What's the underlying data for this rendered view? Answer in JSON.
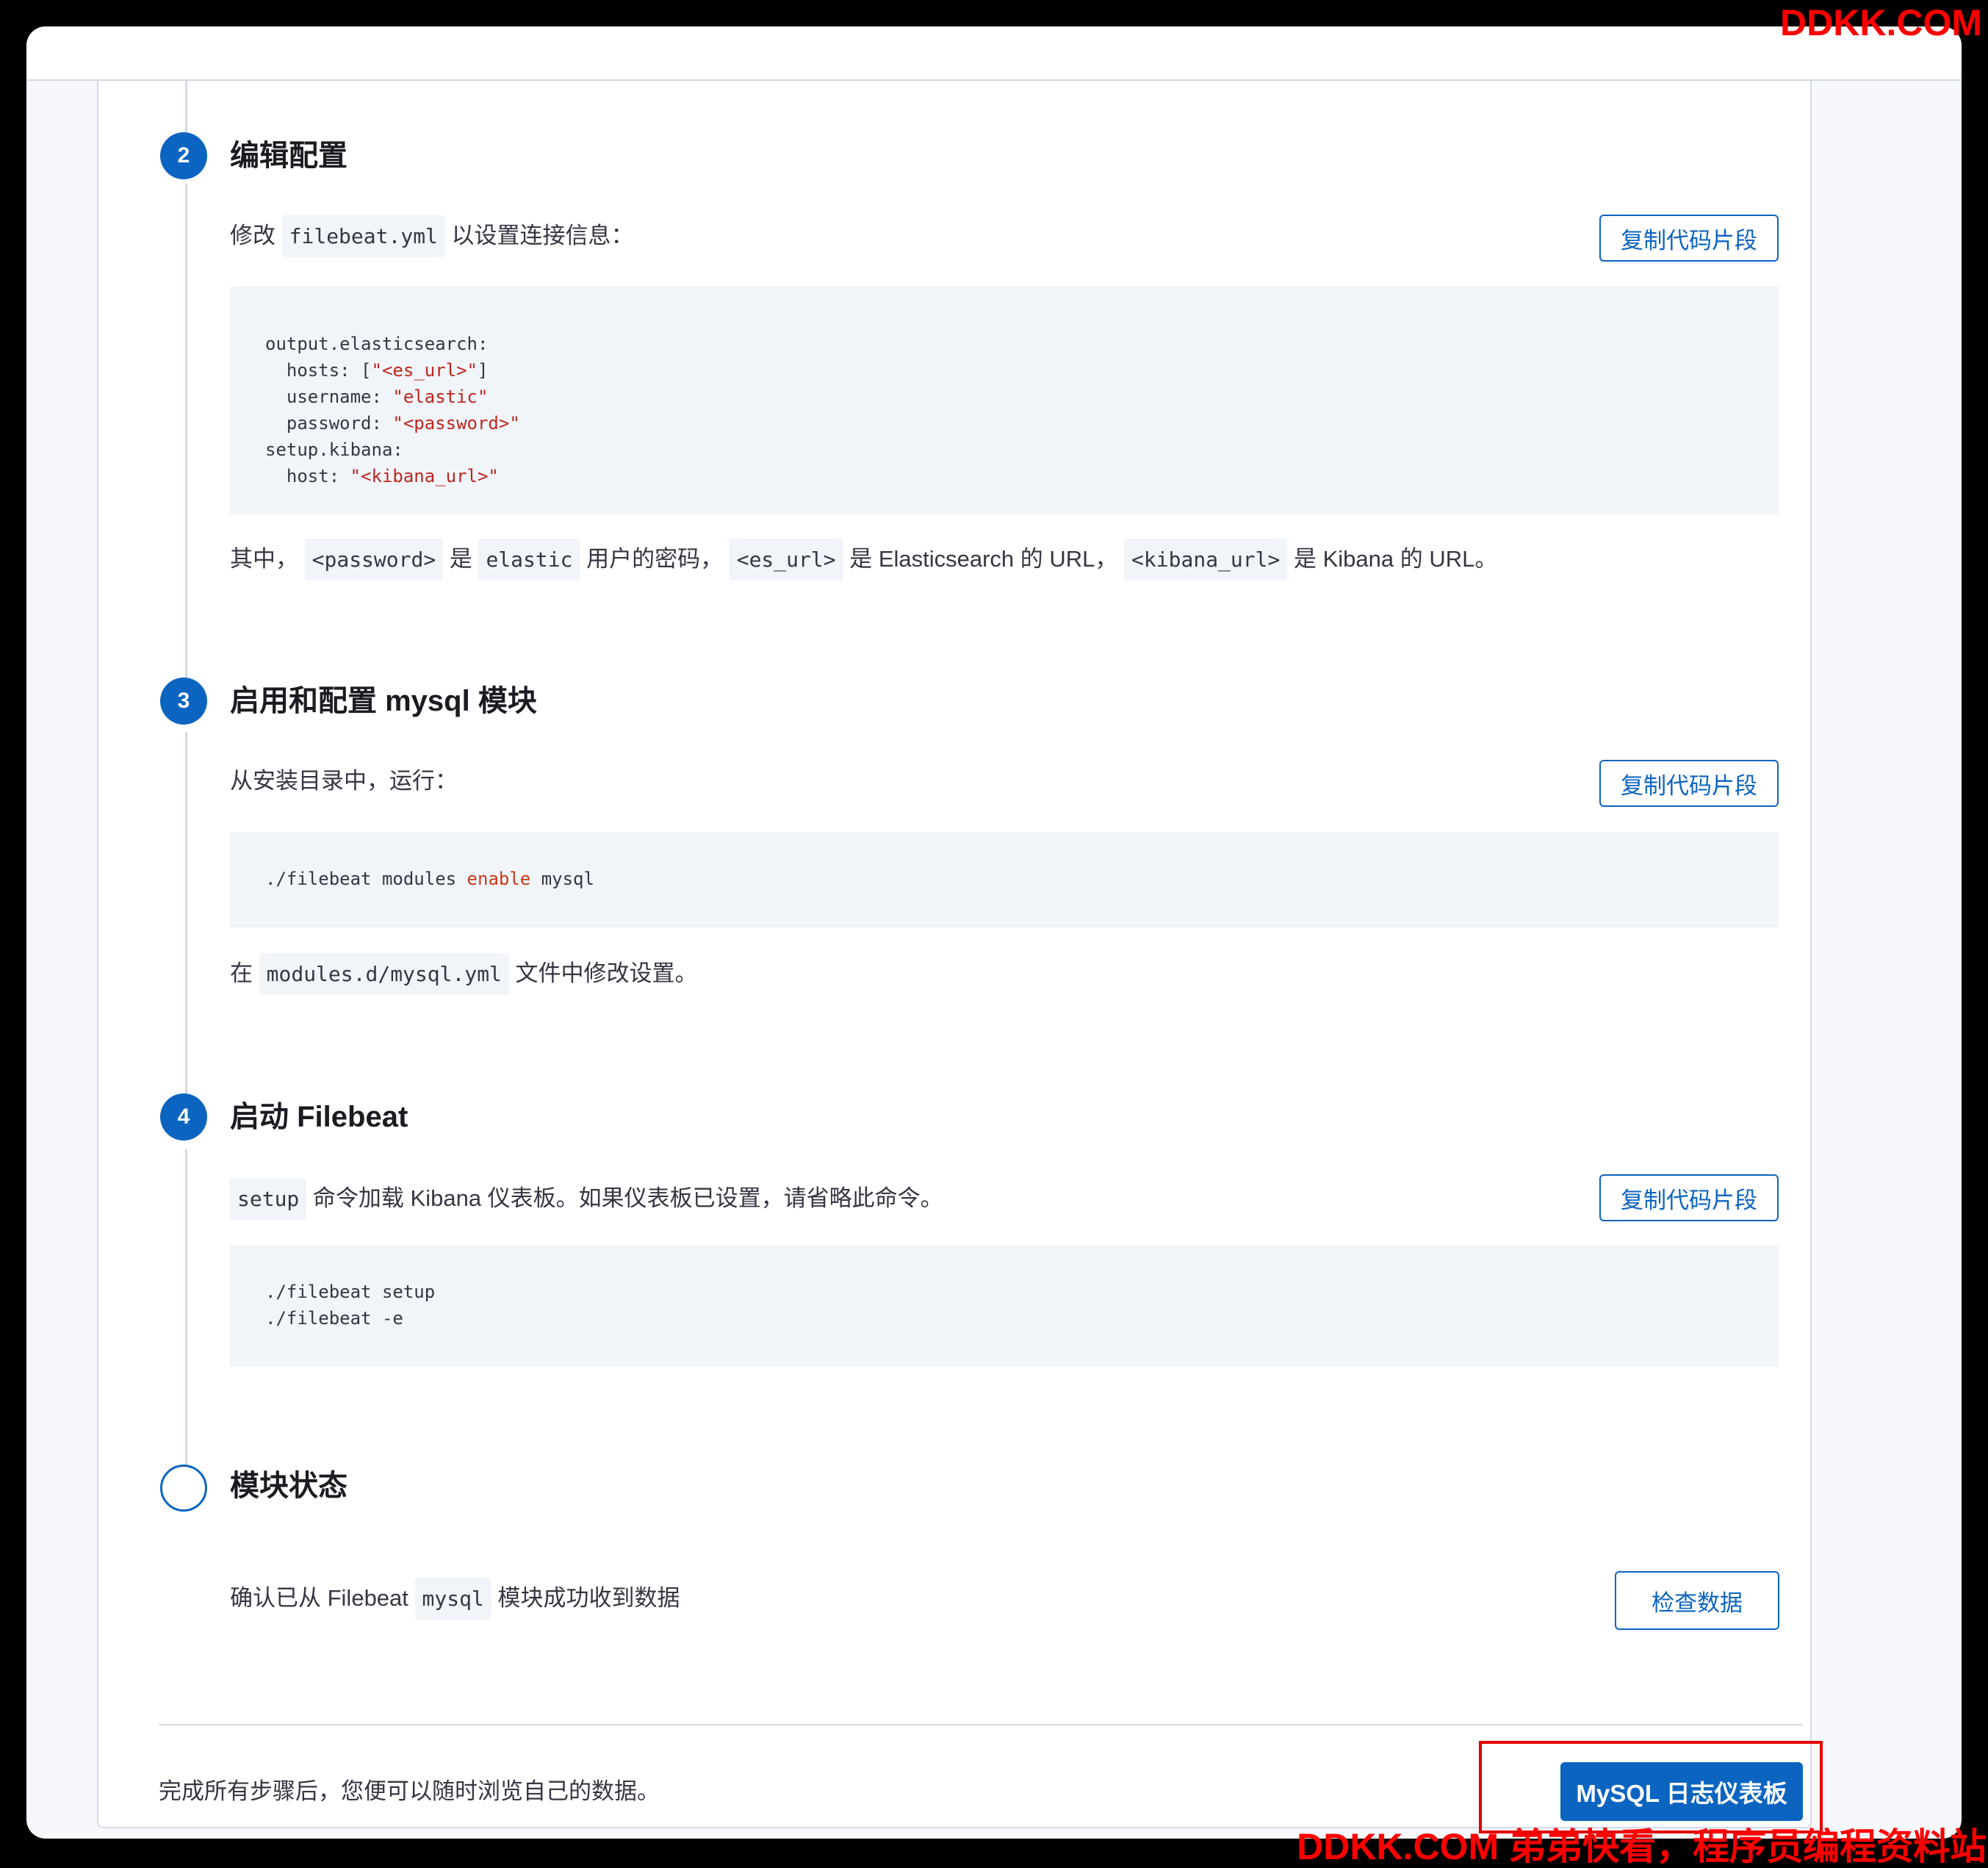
{
  "watermark": {
    "top": "DDKK.COM",
    "bottom": "DDKK.COM 弟弟快看，程序员编程资料站"
  },
  "copy_label": "复制代码片段",
  "step2": {
    "number": "2",
    "title": "编辑配置",
    "intro_prefix": "修改",
    "intro_code": "filebeat.yml",
    "intro_suffix": "以设置连接信息：",
    "code": {
      "l1": "output.elasticsearch:",
      "l2_key": "  hosts: [",
      "l2_val": "\"<es_url>\"",
      "l2_end": "]",
      "l3_key": "  username: ",
      "l3_val": "\"elastic\"",
      "l4_key": "  password: ",
      "l4_val": "\"<password>\"",
      "l5": "setup.kibana:",
      "l6_key": "  host: ",
      "l6_val": "\"<kibana_url>\""
    },
    "note": {
      "t1": "其中，",
      "c1": "<password>",
      "t2": "是",
      "c2": "elastic",
      "t3": "用户的密码，",
      "c3": "<es_url>",
      "t4": "是 Elasticsearch 的 URL，",
      "c4": "<kibana_url>",
      "t5": "是 Kibana 的 URL。"
    }
  },
  "step3": {
    "number": "3",
    "title": "启用和配置 mysql 模块",
    "intro": "从安装目录中，运行：",
    "code": {
      "cmd": "./filebeat modules ",
      "kw": "enable",
      "arg": " mysql"
    },
    "note_prefix": "在",
    "note_code": "modules.d/mysql.yml",
    "note_suffix": "文件中修改设置。"
  },
  "step4": {
    "number": "4",
    "title": "启动 Filebeat",
    "intro_code": "setup",
    "intro_suffix": "命令加载 Kibana 仪表板。如果仪表板已设置，请省略此命令。",
    "code": {
      "l1": "./filebeat setup",
      "l2": "./filebeat -e"
    }
  },
  "status": {
    "title": "模块状态",
    "text_prefix": "确认已从 Filebeat",
    "text_code": "mysql",
    "text_suffix": "模块成功收到数据",
    "check_label": "检查数据"
  },
  "footer": {
    "text": "完成所有步骤后，您便可以随时浏览自己的数据。",
    "button_label": "MySQL 日志仪表板"
  },
  "colors": {
    "accent": "#0b64c0",
    "code_bg": "#f1f4f9",
    "highlight": "#e30000",
    "watermark": "#ff0000"
  }
}
